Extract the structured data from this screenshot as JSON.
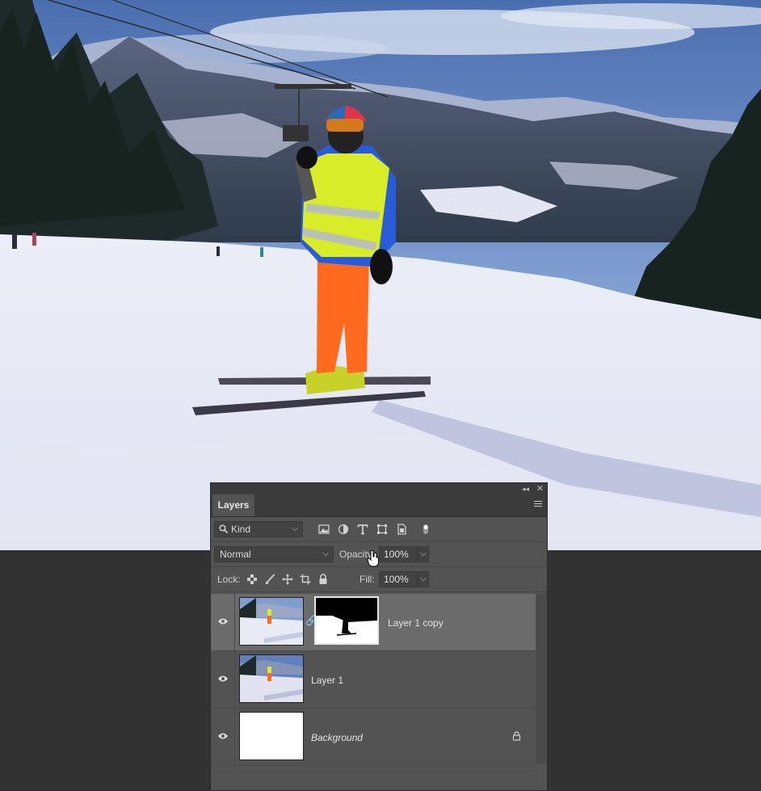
{
  "panel": {
    "tab_label": "Layers",
    "kind_filter": "Kind",
    "blend_mode": "Normal",
    "opacity_label": "Opacity:",
    "opacity_value": "100%",
    "lock_label": "Lock:",
    "fill_label": "Fill:",
    "fill_value": "100%",
    "filter_icons": [
      "image-filter-icon",
      "adjustment-filter-icon",
      "type-filter-icon",
      "shape-filter-icon",
      "smart-object-filter-icon",
      "filter-toggle-icon"
    ],
    "lock_icons": [
      "lock-transparent-pixels-icon",
      "lock-image-pixels-icon",
      "lock-position-icon",
      "lock-artboard-icon",
      "lock-all-icon"
    ]
  },
  "layers": [
    {
      "name": "Layer 1 copy",
      "visible": true,
      "selected": true,
      "has_mask": true,
      "locked": false
    },
    {
      "name": "Layer 1",
      "visible": true,
      "selected": false,
      "has_mask": false,
      "locked": false
    },
    {
      "name": "Background",
      "visible": true,
      "selected": false,
      "has_mask": false,
      "locked": true
    }
  ],
  "colors": {
    "panel_bg": "#535353",
    "selected_row": "#6b6b6b",
    "workspace_bg": "#323232"
  }
}
